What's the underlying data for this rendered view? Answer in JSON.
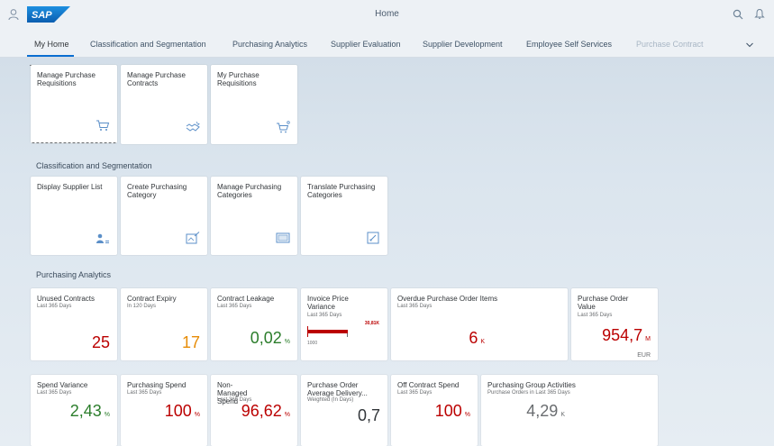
{
  "shell": {
    "title": "Home",
    "logo_text": "SAP",
    "user_icon": "user-icon",
    "search_icon": "search-icon",
    "notifications_icon": "bell-icon"
  },
  "tabs": [
    {
      "label": "My Home",
      "active": true
    },
    {
      "label": "Classification and Segmentation"
    },
    {
      "label": "Purchasing Analytics"
    },
    {
      "label": "Supplier Evaluation"
    },
    {
      "label": "Supplier Development"
    },
    {
      "label": "Employee Self Services"
    },
    {
      "label": "Purchase Contract"
    }
  ],
  "my_home": {
    "tiles": [
      {
        "title": "Manage Purchase Requisitions",
        "icon": "cart-icon"
      },
      {
        "title": "Manage Purchase Contracts",
        "icon": "handshake-icon"
      },
      {
        "title": "My Purchase Requisitions",
        "icon": "cart-icon"
      }
    ]
  },
  "classification": {
    "title": "Classification and Segmentation",
    "tiles": [
      {
        "title": "Display Supplier List",
        "icon": "supplier-list-icon"
      },
      {
        "title": "Create Purchasing Category",
        "icon": "category-create-icon"
      },
      {
        "title": "Manage Purchasing Categories",
        "icon": "category-manage-icon"
      },
      {
        "title": "Translate Purchasing Categories",
        "icon": "translate-icon"
      }
    ]
  },
  "analytics": {
    "title": "Purchasing Analytics",
    "row1": [
      {
        "title": "Unused Contracts",
        "sub": "Last 365 Days",
        "value": "25",
        "unit": "",
        "color": "#bb0000"
      },
      {
        "title": "Contract Expiry",
        "sub": "In 120 Days",
        "value": "17",
        "unit": "",
        "color": "#e78c07"
      },
      {
        "title": "Contract Leakage",
        "sub": "Last 365 Days",
        "value": "0,02",
        "unit": "%",
        "color": "#2b7d2b"
      },
      {
        "title": "Invoice Price Variance",
        "sub": "Last 365 Days",
        "bar_label": "30,81K",
        "bar_min": "1000",
        "bar_fraction": 0.56
      },
      {
        "title": "Overdue Purchase Order Items",
        "sub": "Last 365 Days",
        "value": "6",
        "unit": "K",
        "color": "#bb0000"
      },
      {
        "title": "Purchase Order Value",
        "sub": "Last 365 Days",
        "value": "954,7",
        "unit": "M",
        "scale": "EUR",
        "color": "#bb0000"
      }
    ],
    "row2": [
      {
        "title": "Spend Variance",
        "sub": "Last 365 Days",
        "value": "2,43",
        "unit": "%",
        "color": "#2b7d2b"
      },
      {
        "title": "Purchasing Spend",
        "sub": "Last 365 Days",
        "value": "100",
        "unit": "%",
        "color": "#bb0000"
      },
      {
        "title": "Non-Managed Spend",
        "sub": "Last 365 Days",
        "value": "96,62",
        "unit": "%",
        "color": "#bb0000"
      },
      {
        "title": "Purchase Order Average Delivery...",
        "sub": "Weighted (In Days)",
        "value": "0,7",
        "unit": "",
        "color": "#32363a"
      },
      {
        "title": "Off Contract Spend",
        "sub": "Last 365 Days",
        "value": "100",
        "unit": "%",
        "color": "#bb0000"
      },
      {
        "title": "Purchasing Group Activities",
        "sub": "Purchase Orders in Last 365 Days",
        "value": "4,29",
        "unit": "K",
        "color": "#6a6d70"
      }
    ]
  }
}
